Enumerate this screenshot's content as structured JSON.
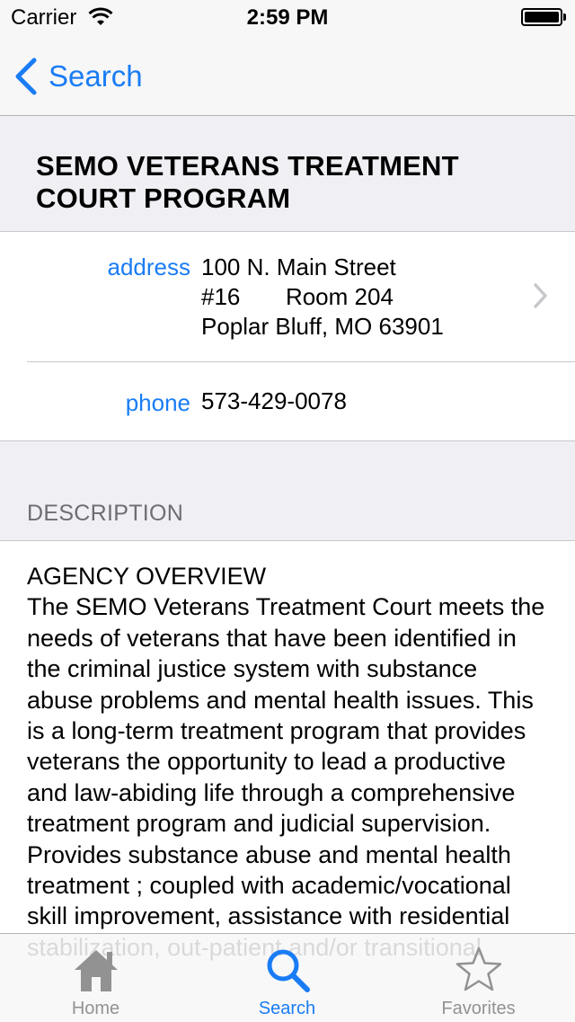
{
  "status_bar": {
    "carrier": "Carrier",
    "time": "2:59 PM",
    "battery_level": 1.0
  },
  "nav": {
    "back_label": "Search",
    "back_icon": "chevron-left-icon"
  },
  "detail": {
    "title": "SEMO VETERANS TREATMENT COURT PROGRAM",
    "address_label": "address",
    "address_lines": [
      "100 N. Main Street",
      "#16       Room 204",
      "Poplar Bluff, MO 63901"
    ],
    "phone_label": "phone",
    "phone": "573-429-0078"
  },
  "description": {
    "header": "DESCRIPTION",
    "body": "AGENCY OVERVIEW\nThe SEMO Veterans Treatment Court meets the needs of veterans that have been identified in the criminal justice system with substance abuse problems and mental health issues. This is a long-term treatment program that provides veterans the opportunity to lead a productive and law-abiding life through a comprehensive treatment program and judicial supervision. Provides substance abuse and mental health treatment ; coupled with academic/vocational skill improvement, assistance with residential stabilization, out-patient and/or transitional"
  },
  "tab_bar": {
    "tabs": [
      {
        "label": "Home",
        "icon": "home-icon",
        "active": false
      },
      {
        "label": "Search",
        "icon": "search-icon",
        "active": true
      },
      {
        "label": "Favorites",
        "icon": "star-icon",
        "active": false
      }
    ]
  },
  "colors": {
    "accent": "#1a7cf5",
    "grouped_background": "#efeff4",
    "inactive_tab": "#929292"
  }
}
